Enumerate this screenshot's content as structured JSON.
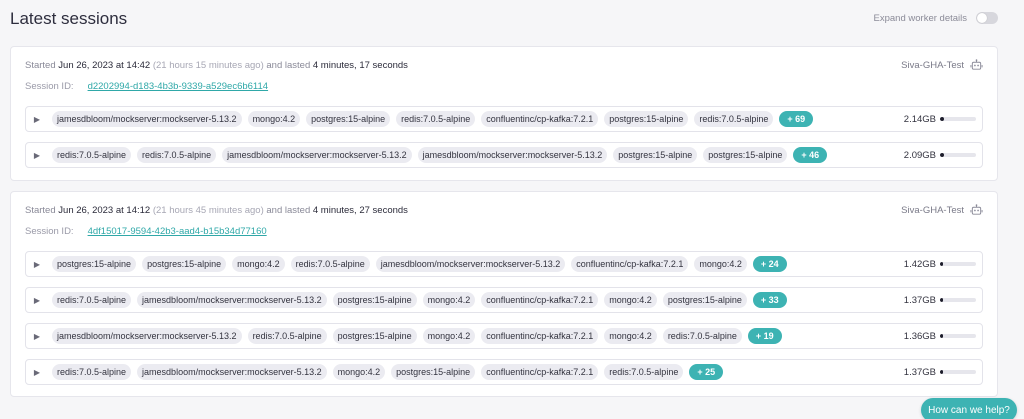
{
  "header": {
    "title": "Latest sessions",
    "expand_label": "Expand worker details",
    "expand_enabled": false
  },
  "sessions": [
    {
      "started_prefix": "Started",
      "started_at": "Jun 26, 2023 at 14:42",
      "relative": "(21 hours 15 minutes ago)",
      "lasted_prefix": "and lasted",
      "duration": "4 minutes, 17 seconds",
      "worker": "Siva-GHA-Test",
      "session_id_label": "Session ID:",
      "session_id": "d2202994-d183-4b3b-9339-a529ec6b6114",
      "jobs": [
        {
          "chips": [
            "jamesdbloom/mockserver:mockserver-5.13.2",
            "mongo:4.2",
            "postgres:15-alpine",
            "redis:7.0.5-alpine",
            "confluentinc/cp-kafka:7.2.1",
            "postgres:15-alpine",
            "redis:7.0.5-alpine"
          ],
          "more": "+ 69",
          "usage": "2.14GB",
          "usage_fraction": 0.12
        },
        {
          "chips": [
            "redis:7.0.5-alpine",
            "redis:7.0.5-alpine",
            "jamesdbloom/mockserver:mockserver-5.13.2",
            "jamesdbloom/mockserver:mockserver-5.13.2",
            "postgres:15-alpine",
            "postgres:15-alpine"
          ],
          "more": "+ 46",
          "usage": "2.09GB",
          "usage_fraction": 0.12
        }
      ]
    },
    {
      "started_prefix": "Started",
      "started_at": "Jun 26, 2023 at 14:12",
      "relative": "(21 hours 45 minutes ago)",
      "lasted_prefix": "and lasted",
      "duration": "4 minutes, 27 seconds",
      "worker": "Siva-GHA-Test",
      "session_id_label": "Session ID:",
      "session_id": "4df15017-9594-42b3-aad4-b15b34d77160",
      "jobs": [
        {
          "chips": [
            "postgres:15-alpine",
            "postgres:15-alpine",
            "mongo:4.2",
            "redis:7.0.5-alpine",
            "jamesdbloom/mockserver:mockserver-5.13.2",
            "confluentinc/cp-kafka:7.2.1",
            "mongo:4.2"
          ],
          "more": "+ 24",
          "usage": "1.42GB",
          "usage_fraction": 0.08
        },
        {
          "chips": [
            "redis:7.0.5-alpine",
            "jamesdbloom/mockserver:mockserver-5.13.2",
            "postgres:15-alpine",
            "mongo:4.2",
            "confluentinc/cp-kafka:7.2.1",
            "mongo:4.2",
            "postgres:15-alpine"
          ],
          "more": "+ 33",
          "usage": "1.37GB",
          "usage_fraction": 0.08
        },
        {
          "chips": [
            "jamesdbloom/mockserver:mockserver-5.13.2",
            "redis:7.0.5-alpine",
            "postgres:15-alpine",
            "mongo:4.2",
            "confluentinc/cp-kafka:7.2.1",
            "mongo:4.2",
            "redis:7.0.5-alpine"
          ],
          "more": "+ 19",
          "usage": "1.36GB",
          "usage_fraction": 0.08
        },
        {
          "chips": [
            "redis:7.0.5-alpine",
            "jamesdbloom/mockserver:mockserver-5.13.2",
            "mongo:4.2",
            "postgres:15-alpine",
            "confluentinc/cp-kafka:7.2.1",
            "redis:7.0.5-alpine"
          ],
          "more": "+ 25",
          "usage": "1.37GB",
          "usage_fraction": 0.08
        }
      ]
    }
  ],
  "help": {
    "label": "How can we help?"
  },
  "colors": {
    "accent": "#3db3b3",
    "link": "#2fa8a8",
    "chip_bg": "#ebebf1",
    "bar_fill": "#1d1d2b"
  }
}
